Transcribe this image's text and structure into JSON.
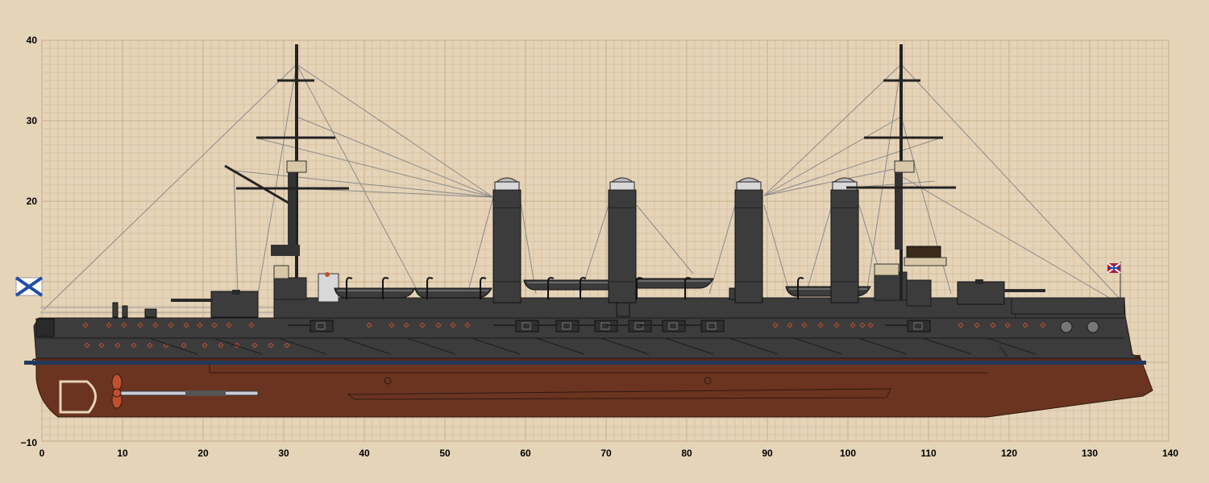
{
  "colors": {
    "background": "#e6d4b9",
    "grid_minor": "#d8c2a4",
    "grid_major": "#c6ab86",
    "hull_upper": "#3c3c3c",
    "hull_dark": "#303030",
    "hull_lower": "#6b3420",
    "waterline": "#1f3a5c",
    "port_accent": "#c0502e",
    "rigging": "#8a8a8a",
    "deck_light": "#d8d8d8"
  },
  "axes": {
    "x_ticks": [
      "0",
      "10",
      "20",
      "30",
      "40",
      "50",
      "60",
      "70",
      "80",
      "90",
      "100",
      "110",
      "120",
      "130",
      "140"
    ],
    "y_ticks": [
      "40",
      "30",
      "20",
      "10",
      "0",
      "−10"
    ]
  },
  "ship": {
    "funnels": 4,
    "masts": 2,
    "ensign_icon": "st-andrew-cross-flag",
    "jack_icon": "russian-jack-flag"
  }
}
